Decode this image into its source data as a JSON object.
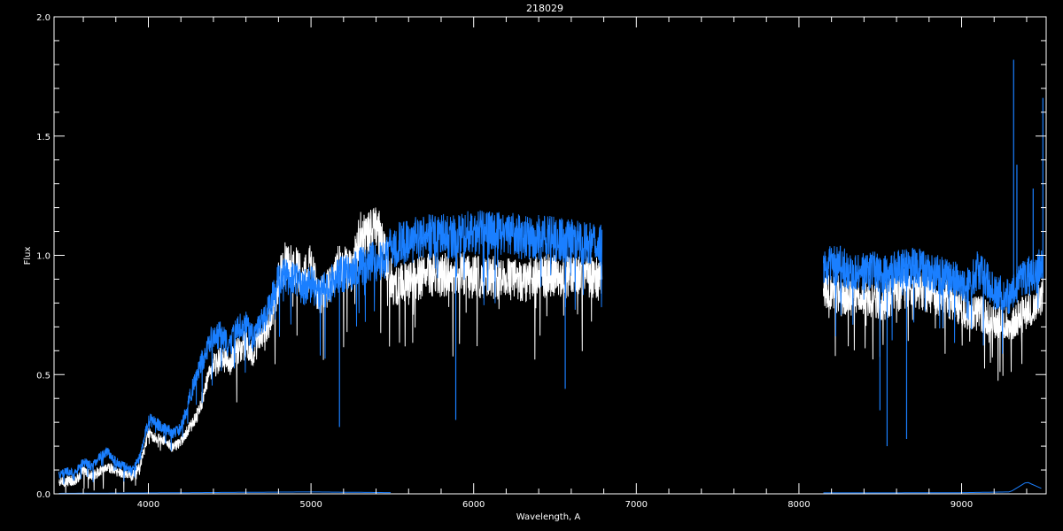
{
  "chart_data": {
    "type": "line",
    "title": "218029",
    "xlabel": "Wavelength, A",
    "ylabel": "Flux",
    "xlim": [
      3420,
      9520
    ],
    "ylim": [
      0,
      2.0
    ],
    "x_ticks": [
      4000,
      5000,
      6000,
      7000,
      8000,
      9000
    ],
    "x_tick_labels": [
      "4000",
      "5000",
      "6000",
      "7000",
      "8000",
      "9000"
    ],
    "y_ticks": [
      0.0,
      0.5,
      1.0,
      1.5,
      2.0
    ],
    "y_tick_labels": [
      "0.0",
      "0.5",
      "1.0",
      "1.5",
      "2.0"
    ],
    "grid": false,
    "background": "#000000",
    "axis_color": "#ffffff",
    "series": [
      {
        "color": "#ffffff",
        "segments": [
          {
            "x": [
              3450,
              3500,
              3550,
              3600,
              3650,
              3700,
              3750,
              3800,
              3850,
              3900,
              3950,
              4000,
              4050,
              4100,
              4150,
              4200,
              4250,
              4300,
              4350,
              4400,
              4450,
              4500,
              4550,
              4600,
              4650,
              4700,
              4750,
              4800,
              4850,
              4900,
              4950,
              5000,
              5050,
              5100,
              5150,
              5200,
              5250,
              5300,
              5350,
              5400,
              5450,
              5500,
              5600,
              5700,
              5800,
              5900,
              6000,
              6100,
              6200,
              6300,
              6400,
              6500,
              6600,
              6700,
              6790
            ],
            "y": [
              0.05,
              0.06,
              0.06,
              0.1,
              0.08,
              0.1,
              0.12,
              0.1,
              0.09,
              0.08,
              0.12,
              0.26,
              0.24,
              0.23,
              0.2,
              0.22,
              0.28,
              0.34,
              0.45,
              0.55,
              0.58,
              0.56,
              0.62,
              0.64,
              0.6,
              0.7,
              0.74,
              0.92,
              1.0,
              0.98,
              0.92,
              0.98,
              0.84,
              0.88,
              0.96,
              0.98,
              0.94,
              1.1,
              1.1,
              1.14,
              1.06,
              0.9,
              0.9,
              0.94,
              0.94,
              0.95,
              0.93,
              0.93,
              0.92,
              0.91,
              0.93,
              0.94,
              0.93,
              0.93,
              0.92
            ]
          },
          {
            "x": [
              8150,
              8200,
              8250,
              8300,
              8350,
              8400,
              8450,
              8500,
              8550,
              8600,
              8650,
              8700,
              8750,
              8800,
              8850,
              8900,
              8950,
              9000,
              9050,
              9100,
              9150,
              9200,
              9250,
              9300,
              9350,
              9400,
              9450,
              9500
            ],
            "y": [
              0.86,
              0.88,
              0.85,
              0.84,
              0.86,
              0.84,
              0.84,
              0.82,
              0.84,
              0.86,
              0.88,
              0.87,
              0.88,
              0.86,
              0.85,
              0.84,
              0.82,
              0.8,
              0.76,
              0.78,
              0.76,
              0.74,
              0.74,
              0.72,
              0.76,
              0.78,
              0.8,
              0.86
            ]
          }
        ]
      },
      {
        "color": "#1a7fff",
        "segments": [
          {
            "x": [
              3450,
              3500,
              3550,
              3600,
              3650,
              3700,
              3750,
              3800,
              3850,
              3900,
              3950,
              4000,
              4050,
              4100,
              4150,
              4200,
              4250,
              4300,
              4350,
              4400,
              4450,
              4500,
              4550,
              4600,
              4650,
              4700,
              4750,
              4800,
              4850,
              4900,
              4950,
              5000,
              5050,
              5100,
              5150,
              5200,
              5250,
              5300,
              5350,
              5400,
              5450,
              5500,
              5600,
              5700,
              5800,
              5900,
              6000,
              6100,
              6200,
              6300,
              6400,
              6500,
              6600,
              6700,
              6790
            ],
            "y": [
              0.08,
              0.1,
              0.09,
              0.14,
              0.12,
              0.16,
              0.18,
              0.14,
              0.12,
              0.1,
              0.16,
              0.32,
              0.3,
              0.28,
              0.26,
              0.28,
              0.4,
              0.52,
              0.6,
              0.68,
              0.68,
              0.62,
              0.72,
              0.72,
              0.66,
              0.74,
              0.8,
              0.92,
              0.94,
              0.92,
              0.88,
              0.9,
              0.86,
              0.88,
              0.92,
              0.94,
              0.94,
              0.98,
              0.98,
              1.0,
              1.0,
              1.06,
              1.08,
              1.1,
              1.1,
              1.1,
              1.12,
              1.12,
              1.11,
              1.1,
              1.1,
              1.09,
              1.08,
              1.07,
              1.06
            ]
          },
          {
            "x": [
              8150,
              8200,
              8250,
              8300,
              8350,
              8400,
              8450,
              8500,
              8550,
              8600,
              8650,
              8700,
              8750,
              8800,
              8850,
              8900,
              8950,
              9000,
              9050,
              9100,
              9150,
              9200,
              9250,
              9300,
              9350,
              9400,
              9450,
              9500
            ],
            "y": [
              0.96,
              0.98,
              0.98,
              0.96,
              0.96,
              0.95,
              0.96,
              0.94,
              0.95,
              0.96,
              0.97,
              0.97,
              0.96,
              0.95,
              0.94,
              0.93,
              0.92,
              0.9,
              0.9,
              0.96,
              0.92,
              0.86,
              0.86,
              0.84,
              0.9,
              0.94,
              0.92,
              1.0
            ]
          }
        ]
      },
      {
        "color": "#1a7fff",
        "segments": [
          {
            "x": [
              3450,
              4000,
              4500,
              5000,
              5500
            ],
            "y": [
              0.002,
              0.004,
              0.006,
              0.008,
              0.005
            ]
          },
          {
            "x": [
              8150,
              8500,
              9000,
              9300,
              9400,
              9500
            ],
            "y": [
              0.004,
              0.004,
              0.005,
              0.008,
              0.05,
              0.02
            ]
          }
        ]
      }
    ],
    "annotations_absorption_lines": [
      {
        "x": 5175,
        "y": 0.28
      },
      {
        "x": 5890,
        "y": 0.31
      },
      {
        "x": 6563,
        "y": 0.44
      },
      {
        "x": 8498,
        "y": 0.35
      },
      {
        "x": 8542,
        "y": 0.2
      },
      {
        "x": 8662,
        "y": 0.23
      }
    ],
    "annotations_emission_spikes": [
      {
        "x": 9320,
        "y": 1.82
      },
      {
        "x": 9340,
        "y": 1.38
      },
      {
        "x": 9440,
        "y": 1.28
      },
      {
        "x": 9500,
        "y": 1.66
      }
    ]
  }
}
